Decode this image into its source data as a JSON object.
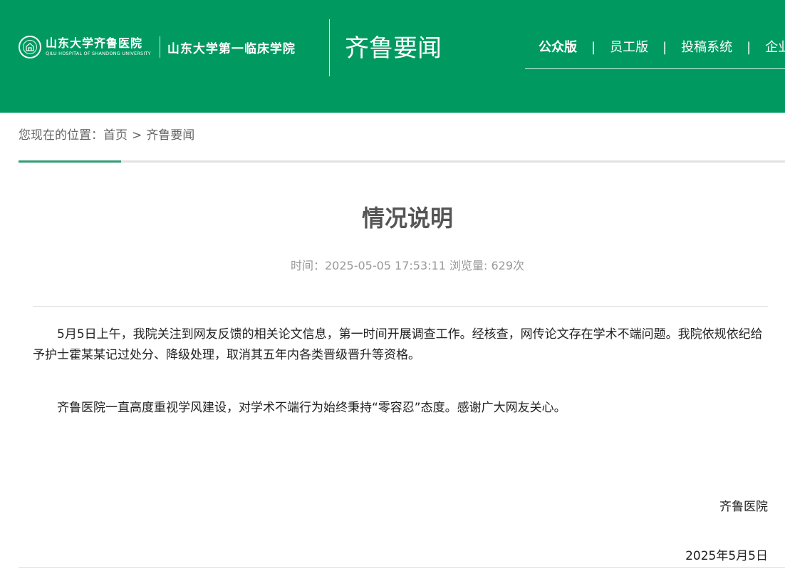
{
  "header": {
    "hospital_name": "山东大学齐鲁医院",
    "hospital_name_en": "QILU HOSPITAL OF SHANDONG UNIVERSITY",
    "school_name": "山东大学第一临床学院",
    "section_title": "齐鲁要闻",
    "nav": [
      {
        "label": "公众版",
        "active": true
      },
      {
        "label": "员工版"
      },
      {
        "label": "投稿系统"
      },
      {
        "label": "企业"
      }
    ],
    "nav_separator": "|",
    "brand_color": "#009a61"
  },
  "breadcrumb": {
    "prefix": "您现在的位置：",
    "home": "首页",
    "separator": ">",
    "current": "齐鲁要闻"
  },
  "article": {
    "title": "情况说明",
    "meta_time_label": "时间：",
    "meta_time": "2025-05-05 17:53:11",
    "meta_views_label": "浏览量:",
    "meta_views": "629次",
    "paragraphs": [
      "5月5日上午，我院关注到网友反馈的相关论文信息，第一时间开展调查工作。经核查，网传论文存在学术不端问题。我院依规依纪给予护士霍某某记过处分、降级处理，取消其五年内各类晋级晋升等资格。",
      "齐鲁医院一直高度重视学风建设，对学术不端行为始终秉持“零容忍”态度。感谢广大网友关心。"
    ],
    "signature": "齐鲁医院",
    "date": "2025年5月5日"
  }
}
